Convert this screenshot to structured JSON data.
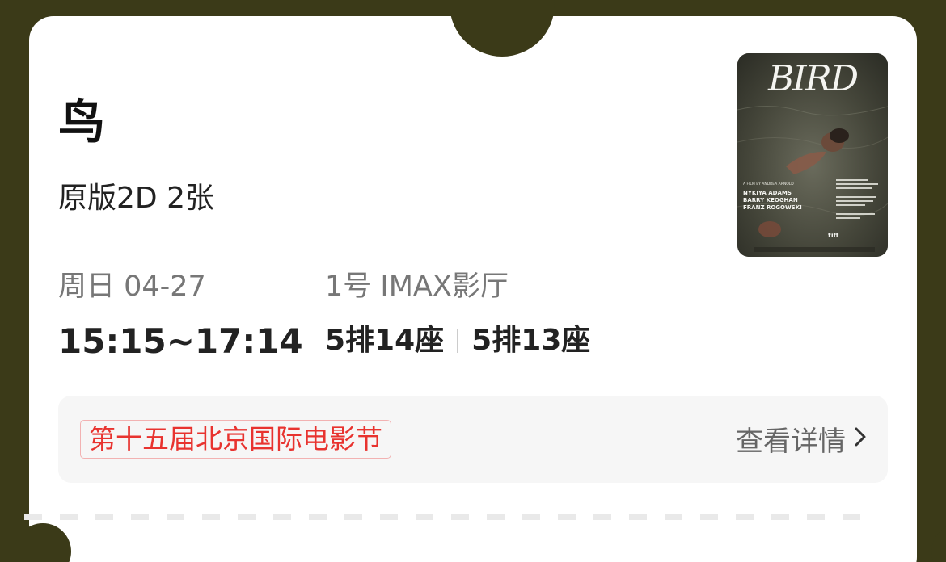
{
  "movie": {
    "title": "鸟",
    "format": "原版2D 2张",
    "poster": {
      "title_art": "BIRD",
      "cast": [
        "NYKIYA ADAMS",
        "BARRY KEOGHAN",
        "FRANZ ROGOWSKI"
      ],
      "director_line": "A FILM BY ANDREA ARNOLD",
      "logo": "tiff"
    }
  },
  "show": {
    "date": "周日 04-27",
    "time": "15:15~17:14",
    "hall": "1号 IMAX影厅",
    "seats": [
      "5排14座",
      "5排13座"
    ]
  },
  "festival": {
    "tag": "第十五届北京国际电影节",
    "details_label": "查看详情"
  },
  "colors": {
    "background": "#3b3a18",
    "card": "#ffffff",
    "festival_red": "#e8332f",
    "panel": "#f6f6f6"
  },
  "icons": {
    "details": "chevron-right-icon"
  }
}
